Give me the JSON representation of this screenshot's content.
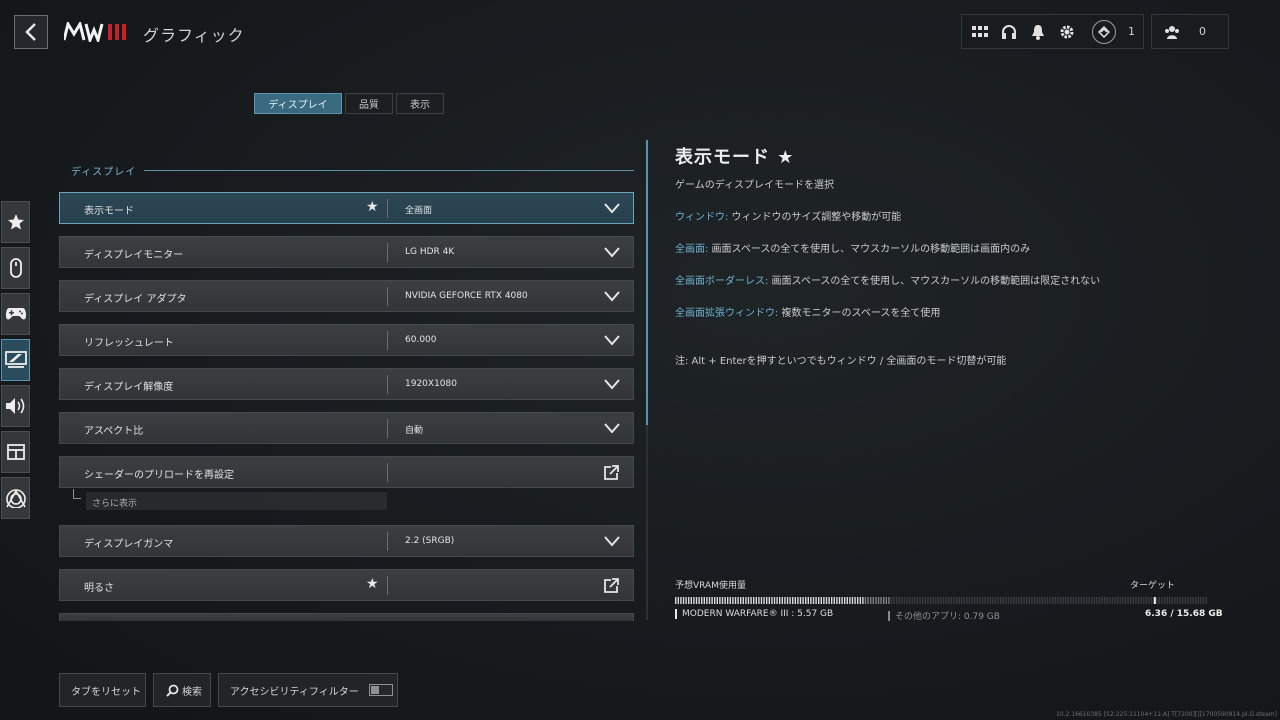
{
  "header": {
    "title": "グラフィック",
    "logo_text": "MWIII",
    "rank_count": "1",
    "friends_count": "0"
  },
  "tabs": [
    {
      "label": "ディスプレイ",
      "active": true
    },
    {
      "label": "品質",
      "active": false
    },
    {
      "label": "表示",
      "active": false
    }
  ],
  "section": {
    "label": "ディスプレイ"
  },
  "settings": [
    {
      "label": "表示モード",
      "value": "全画面",
      "starred": true,
      "control": "dropdown"
    },
    {
      "label": "ディスプレイモニター",
      "value": "LG HDR 4K",
      "starred": false,
      "control": "dropdown"
    },
    {
      "label": "ディスプレイ アダプタ",
      "value": "NVIDIA GEFORCE RTX 4080",
      "starred": false,
      "control": "dropdown"
    },
    {
      "label": "リフレッシュレート",
      "value": "60.000",
      "starred": false,
      "control": "dropdown"
    },
    {
      "label": "ディスプレイ解像度",
      "value": "1920X1080",
      "starred": false,
      "control": "dropdown"
    },
    {
      "label": "アスペクト比",
      "value": "自動",
      "starred": false,
      "control": "dropdown"
    },
    {
      "label": "シェーダーのプリロードを再設定",
      "value": "",
      "starred": false,
      "control": "external"
    },
    {
      "label": "ディスプレイガンマ",
      "value": "2.2 (SRGB)",
      "starred": false,
      "control": "dropdown"
    },
    {
      "label": "明るさ",
      "value": "",
      "starred": true,
      "control": "external"
    }
  ],
  "show_more": "さらに表示",
  "detail": {
    "title": "表示モード ★",
    "subtitle": "ゲームのディスプレイモードを選択",
    "items": [
      {
        "key": "ウィンドウ:",
        "text": " ウィンドウのサイズ調整や移動が可能"
      },
      {
        "key": "全画面:",
        "text": " 画面スペースの全てを使用し、マウスカーソルの移動範囲は画面内のみ"
      },
      {
        "key": "全画面ボーダーレス:",
        "text": " 画面スペースの全てを使用し、マウスカーソルの移動範囲は限定されない"
      },
      {
        "key": "全画面拡張ウィンドウ:",
        "text": " 複数モニターのスペースを全て使用"
      }
    ],
    "note": "注: Alt + Enterを押すといつでもウィンドウ / 全画面のモード切替が可能"
  },
  "vram": {
    "label": "予想VRAM使用量",
    "target_label": "ターゲット",
    "game_label": "MODERN WARFARE® III : 5.57 GB",
    "other_label": "その他のアプリ: 0.79 GB",
    "total_label": "6.36 / 15.68 GB",
    "game_gb": 5.57,
    "other_gb": 0.79,
    "total_gb": 15.68,
    "target_fraction": 0.9
  },
  "bottom": {
    "reset_tab": "タブをリセット",
    "search": "検索",
    "accessibility": "アクセシビリティフィルター",
    "accessibility_on": false
  },
  "version": "10.2.16610385 [S2:225:11104+11:A] T[7200][][1700590914.pl.G.steam]",
  "colors": {
    "accent": "#6fb1d0",
    "active_tab": "#3a6a80"
  }
}
